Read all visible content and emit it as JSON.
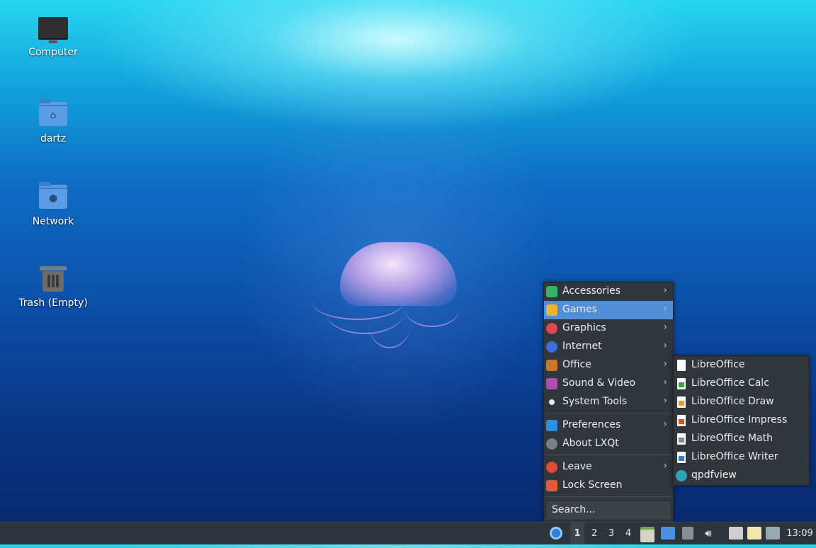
{
  "desktop": {
    "icons": [
      {
        "label": "Computer",
        "icon": "computer-icon"
      },
      {
        "label": "dartz",
        "icon": "home-folder-icon"
      },
      {
        "label": "Network",
        "icon": "network-folder-icon"
      },
      {
        "label": "Trash (Empty)",
        "icon": "trash-icon"
      }
    ]
  },
  "menu": {
    "items": [
      {
        "label": "Accessories",
        "icon": "accessories-icon",
        "color": "#37b26a",
        "submenu": true
      },
      {
        "label": "Games",
        "icon": "games-icon",
        "color": "#f2b233",
        "submenu": true,
        "highlighted": true
      },
      {
        "label": "Graphics",
        "icon": "graphics-icon",
        "color": "#e0474c",
        "submenu": true
      },
      {
        "label": "Internet",
        "icon": "internet-icon",
        "color": "#3a6fd8",
        "submenu": true
      },
      {
        "label": "Office",
        "icon": "office-icon",
        "color": "#c8782a",
        "submenu": true
      },
      {
        "label": "Sound & Video",
        "icon": "sound-video-icon",
        "color": "#b04fb0",
        "submenu": true
      },
      {
        "label": "System Tools",
        "icon": "system-tools-icon",
        "color": "#e8e8e8",
        "submenu": true
      },
      {
        "label": "Preferences",
        "icon": "preferences-icon",
        "color": "#2f8fdc",
        "submenu": true
      },
      {
        "label": "About LXQt",
        "icon": "info-icon",
        "color": "#7a7f85",
        "submenu": false
      },
      {
        "label": "Leave",
        "icon": "power-icon",
        "color": "#e24a3b",
        "submenu": true
      },
      {
        "label": "Lock Screen",
        "icon": "lock-icon",
        "color": "#e25a3b",
        "submenu": false
      }
    ],
    "search_placeholder": "Search..."
  },
  "office_submenu": {
    "items": [
      {
        "label": "LibreOffice",
        "icon": "libreoffice-icon",
        "color": "#ffffff"
      },
      {
        "label": "LibreOffice Calc",
        "icon": "libreoffice-calc-icon",
        "color": "#3aa040"
      },
      {
        "label": "LibreOffice Draw",
        "icon": "libreoffice-draw-icon",
        "color": "#e6a21a"
      },
      {
        "label": "LibreOffice Impress",
        "icon": "libreoffice-impress-icon",
        "color": "#d9502e"
      },
      {
        "label": "LibreOffice Math",
        "icon": "libreoffice-math-icon",
        "color": "#8a8a8a"
      },
      {
        "label": "LibreOffice Writer",
        "icon": "libreoffice-writer-icon",
        "color": "#3b79d0"
      },
      {
        "label": "qpdfview",
        "icon": "qpdfview-icon",
        "color": "#2fa3b8"
      }
    ]
  },
  "panel": {
    "workspaces": [
      "1",
      "2",
      "3",
      "4"
    ],
    "active_workspace": "1",
    "clock": "13:09"
  }
}
